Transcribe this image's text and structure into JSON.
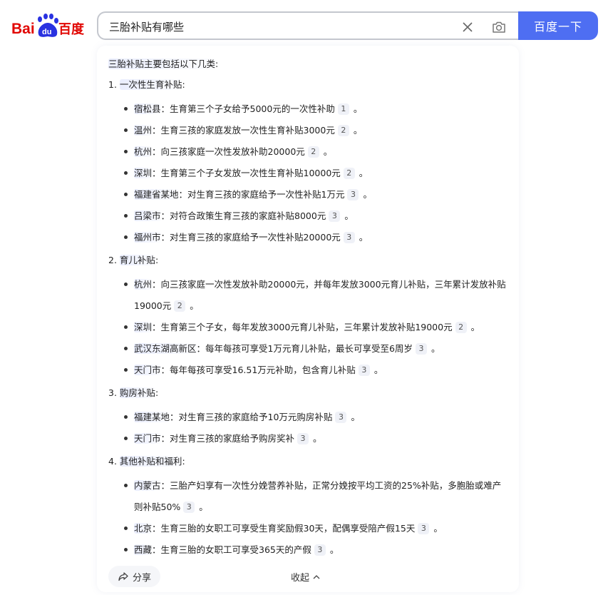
{
  "header": {
    "logo_text": "Bai百度",
    "query": "三胎补贴有哪些",
    "search_button": "百度一下",
    "clear_icon": "close-icon",
    "camera_icon": "camera-icon"
  },
  "colors": {
    "accent": "#4e6ef2",
    "logo_red": "#e10602",
    "logo_blue": "#2932e1"
  },
  "answer": {
    "intro": "三胎补贴主要包括以下几类",
    "intro_suffix": ":",
    "sections": [
      {
        "num": "1.",
        "title": "一次性生育补贴",
        "suffix": ":",
        "items": [
          {
            "place": "宿松县",
            "text": "：生育第三个子女给予5000元的一次性补助",
            "cite": "1",
            "end": "。"
          },
          {
            "place": "温州",
            "text": "：生育三孩的家庭发放一次性生育补贴3000元",
            "cite": "2",
            "end": "。"
          },
          {
            "place": "杭州",
            "text": "：向三孩家庭一次性发放补助20000元",
            "cite": "2",
            "end": "。"
          },
          {
            "place": "深圳",
            "text": "：生育第三个子女发放一次性生育补贴10000元",
            "cite": "2",
            "end": "。"
          },
          {
            "place": "福建省某地",
            "text": "：对生育三孩的家庭给予一次性补贴1万元",
            "cite": "3",
            "end": "。"
          },
          {
            "place": "吕梁市",
            "text": "：对符合政策生育三孩的家庭补贴8000元",
            "cite": "3",
            "end": "。"
          },
          {
            "place": "福州市",
            "text": "：对生育三孩的家庭给予一次性补贴20000元",
            "cite": "3",
            "end": "。"
          }
        ]
      },
      {
        "num": "2.",
        "title": "育儿补贴",
        "suffix": ":",
        "items": [
          {
            "place": "杭州",
            "text": "：向三孩家庭一次性发放补助20000元，并每年发放3000元育儿补贴，三年累计发放补贴19000元",
            "cite": "2",
            "end": "。"
          },
          {
            "place": "深圳",
            "text": "：生育第三个子女，每年发放3000元育儿补贴，三年累计发放补贴19000元",
            "cite": "2",
            "end": "。"
          },
          {
            "place": "武汉东湖高新区",
            "text": "：每年每孩可享受1万元育儿补贴，最长可享受至6周岁",
            "cite": "3",
            "end": "。"
          },
          {
            "place": "天门市",
            "text": "：每年每孩可享受16.51万元补助，包含育儿补贴",
            "cite": "3",
            "end": "。"
          }
        ]
      },
      {
        "num": "3.",
        "title": "购房补贴",
        "suffix": ":",
        "items": [
          {
            "place": "福建某地",
            "text": "：对生育三孩的家庭给予10万元购房补贴",
            "cite": "3",
            "end": "。"
          },
          {
            "place": "天门市",
            "text": "：对生育三孩的家庭给予购房奖补",
            "cite": "3",
            "end": "。"
          }
        ]
      },
      {
        "num": "4.",
        "title": "其他补贴和福利",
        "suffix": ":",
        "items": [
          {
            "place": "内蒙古",
            "text": "：三胎产妇享有一次性分娩营养补贴，正常分娩按平均工资的25%补贴，多胞胎或难产则补贴50%",
            "cite": "3",
            "end": "。"
          },
          {
            "place": "北京",
            "text": "：生育三胎的女职工可享受生育奖励假30天，配偶享受陪产假15天",
            "cite": "3",
            "end": "。"
          },
          {
            "place": "西藏",
            "text": "：生育三胎的女职工可享受365天的产假",
            "cite": "3",
            "end": "。"
          }
        ]
      }
    ]
  },
  "footer": {
    "share_label": "分享",
    "share_icon": "share-icon",
    "collapse_label": "收起",
    "collapse_icon": "chevron-up-icon"
  }
}
